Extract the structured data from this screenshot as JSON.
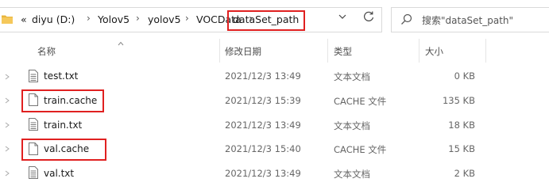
{
  "address_bar": {
    "overflow": "«",
    "crumbs": [
      "diyu (D:)",
      "Yolov5",
      "yolov5",
      "VOCData"
    ],
    "current": "dataSet_path"
  },
  "search": {
    "placeholder": "搜索\"dataSet_path\""
  },
  "columns": {
    "name": "名称",
    "date": "修改日期",
    "type": "类型",
    "size": "大小"
  },
  "files": [
    {
      "name": "test.txt",
      "date": "2021/12/3 13:49",
      "type": "文本文档",
      "size": "0 KB",
      "icon": "text-file-icon",
      "highlighted": false
    },
    {
      "name": "train.cache",
      "date": "2021/12/3 15:39",
      "type": "CACHE 文件",
      "size": "135 KB",
      "icon": "blank-file-icon",
      "highlighted": true
    },
    {
      "name": "train.txt",
      "date": "2021/12/3 13:49",
      "type": "文本文档",
      "size": "18 KB",
      "icon": "text-file-icon",
      "highlighted": false
    },
    {
      "name": "val.cache",
      "date": "2021/12/3 15:40",
      "type": "CACHE 文件",
      "size": "15 KB",
      "icon": "blank-file-icon",
      "highlighted": true
    },
    {
      "name": "val.txt",
      "date": "2021/12/3 13:49",
      "type": "文本文档",
      "size": "2 KB",
      "icon": "text-file-icon",
      "highlighted": false
    }
  ],
  "colors": {
    "highlight": "#e02020",
    "folder": "#e8b53c"
  }
}
